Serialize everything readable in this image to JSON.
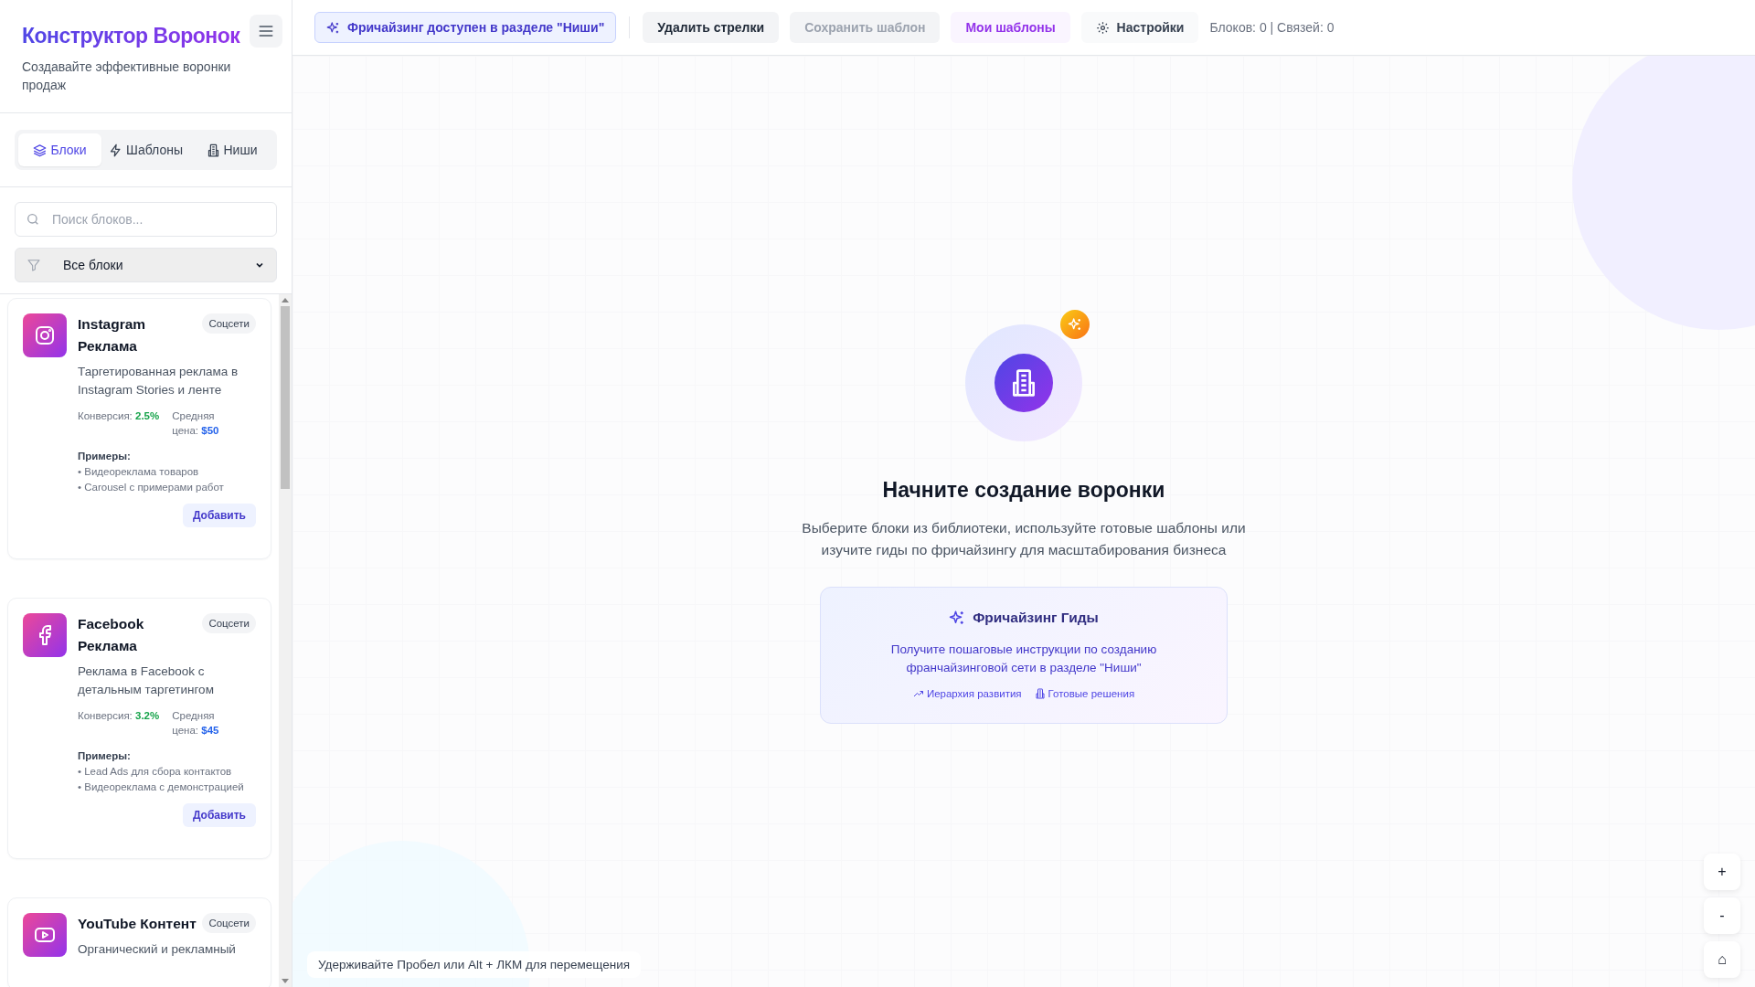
{
  "sidebar": {
    "title": "Конструктор Воронок",
    "subtitle": "Создавайте эффективные воронки продаж",
    "tabs": [
      {
        "label": "Блоки",
        "kind": "layers",
        "selected": true
      },
      {
        "label": "Шаблоны",
        "kind": "bolt",
        "selected": false
      },
      {
        "label": "Ниши",
        "kind": "building",
        "selected": false
      }
    ],
    "search": {
      "placeholder": "Поиск блоков..."
    },
    "filter": {
      "value": "Все блоки"
    },
    "blocks": [
      {
        "kind": "instagram",
        "name": "Instagram Реклама",
        "tag": "Соцсети",
        "description": "Таргетированная реклама в Instagram Stories и ленте",
        "stats": [
          {
            "kind": "conversion",
            "label": "Конверсия:",
            "value": "2.5%"
          },
          {
            "kind": "price",
            "label": "Средняя цена:",
            "value": "$50"
          }
        ],
        "examples_title": "Примеры:",
        "examples": [
          "• Видеореклама товаров",
          "• Carousel с примерами работ"
        ],
        "button": "Добавить"
      },
      {
        "kind": "facebook",
        "name": "Facebook Реклама",
        "tag": "Соцсети",
        "description": "Реклама в Facebook с детальным таргетингом",
        "stats": [
          {
            "kind": "conversion",
            "label": "Конверсия:",
            "value": "3.2%"
          },
          {
            "kind": "price",
            "label": "Средняя цена:",
            "value": "$45"
          }
        ],
        "examples_title": "Примеры:",
        "examples": [
          "• Lead Ads для сбора контактов",
          "• Видеореклама с демонстрацией"
        ],
        "button": "Добавить"
      },
      {
        "kind": "youtube",
        "name": "YouTube Контент",
        "tag": "Соцсети",
        "description": "Органический и рекламный"
      }
    ]
  },
  "toolbar": {
    "franchise_badge": "Фричайзинг доступен в разделе \"Ниши\"",
    "buttons": [
      {
        "label": "Удалить стрелки",
        "kind": "default"
      },
      {
        "label": "Сохранить шаблон",
        "kind": "disabled"
      },
      {
        "label": "Мои шаблоны",
        "kind": "accent"
      },
      {
        "label": "Настройки",
        "kind": "settings"
      }
    ],
    "counts": "Блоков: 0 | Связей: 0"
  },
  "canvas": {
    "heading": "Начните создание воронки",
    "text": "Выберите блоки из библиотеки, используйте готовые шаблоны или изучите гиды по фричайзингу для масштабирования бизнеса",
    "guide": {
      "title": "Фричайзинг Гиды",
      "text": "Получите пошаговые инструкции по созданию франчайзинговой сети в разделе \"Ниши\"",
      "links": [
        {
          "label": "Иерархия развития",
          "kind": "trend"
        },
        {
          "label": "Готовые решения",
          "kind": "building"
        }
      ]
    },
    "zoom_buttons": [
      "+",
      "-",
      "⌂"
    ],
    "hint": "Удерживайте Пробел или Alt + ЛКМ для перемещения"
  }
}
